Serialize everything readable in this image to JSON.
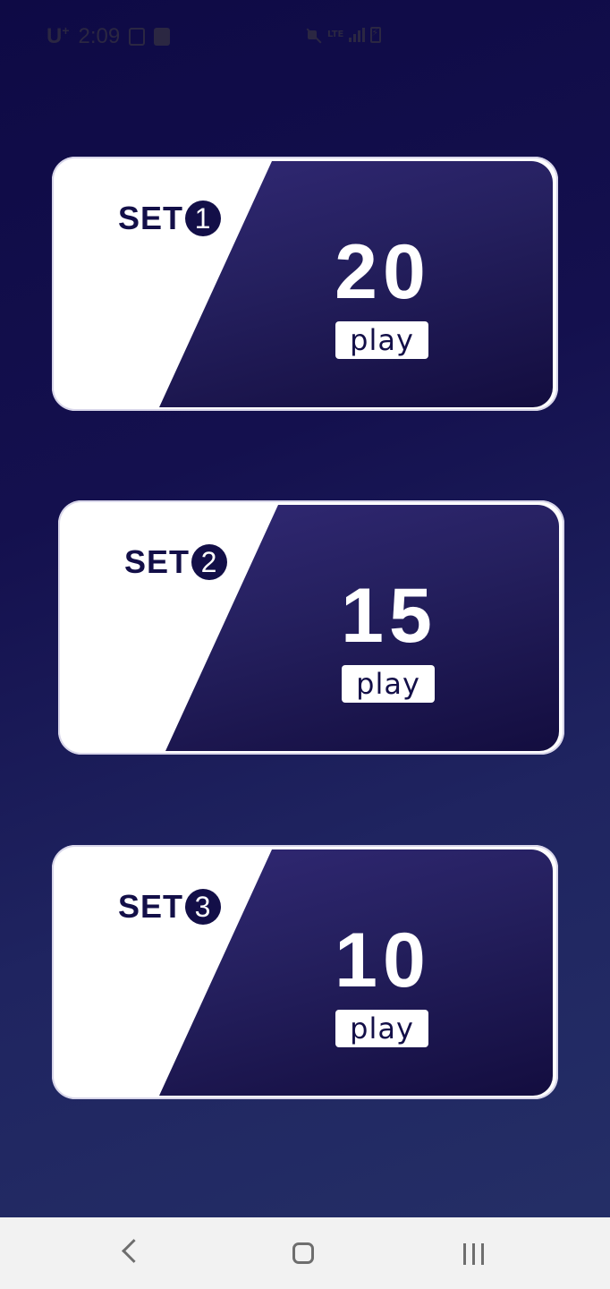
{
  "status_bar": {
    "carrier": "U",
    "carrier_sup": "+",
    "time": "2:09",
    "network": "LTE"
  },
  "sets": [
    {
      "label": "SET",
      "number": "1",
      "count": "20",
      "button": "play"
    },
    {
      "label": "SET",
      "number": "2",
      "count": "15",
      "button": "play"
    },
    {
      "label": "SET",
      "number": "3",
      "count": "10",
      "button": "play"
    }
  ],
  "colors": {
    "background_top": "#0e0a45",
    "background_bottom": "#253067",
    "card_dark": "#25205f",
    "label": "#130f48"
  },
  "nav": {
    "back_icon": "chevron-left-icon",
    "home_icon": "home-square-icon",
    "recent_icon": "recent-apps-icon"
  }
}
